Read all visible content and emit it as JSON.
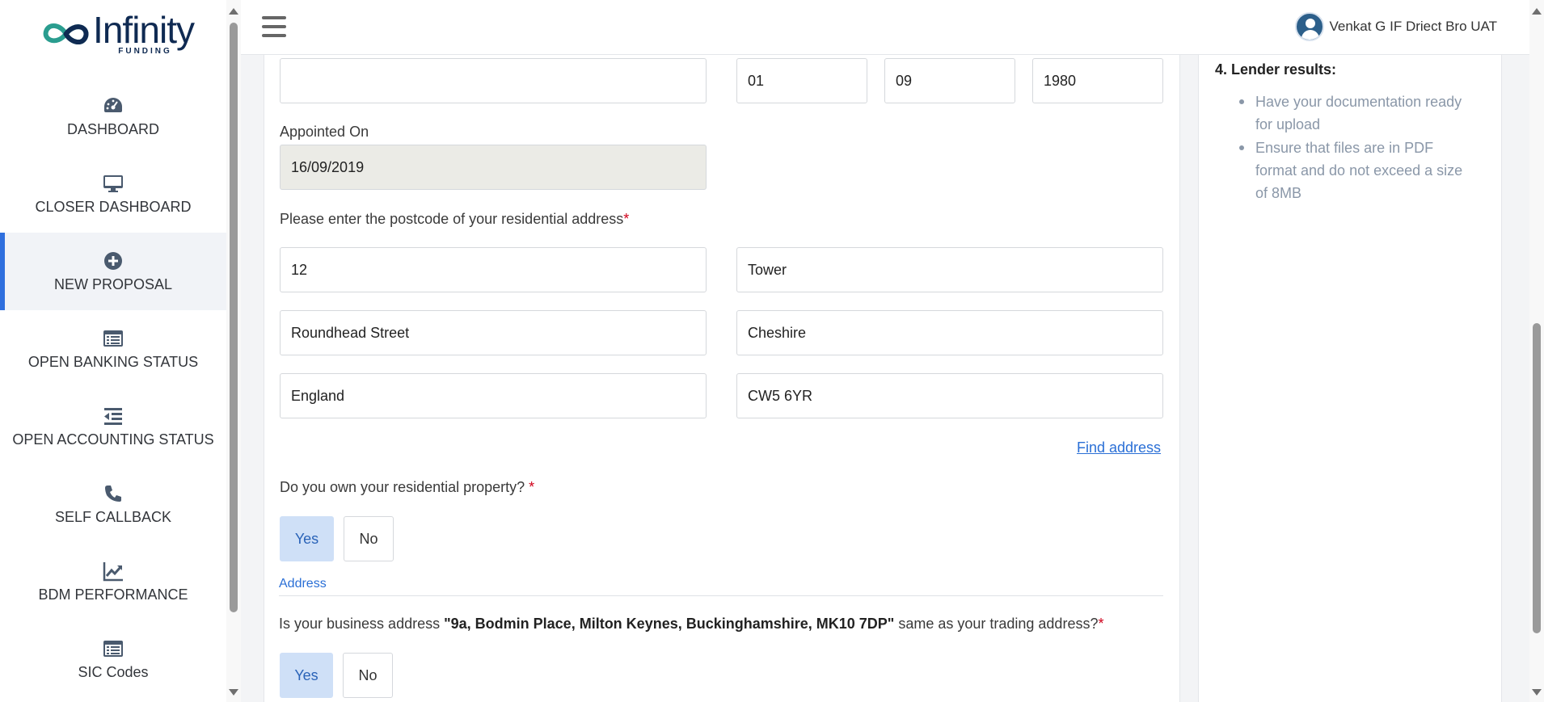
{
  "brand": {
    "name": "Infinity",
    "tagline": "FUNDING"
  },
  "sidebar": {
    "items": [
      {
        "label": "DASHBOARD",
        "icon": "dashboard-gauge-icon"
      },
      {
        "label": "CLOSER DASHBOARD",
        "icon": "monitor-icon"
      },
      {
        "label": "NEW PROPOSAL",
        "icon": "plus-circle-icon",
        "active": true
      },
      {
        "label": "OPEN BANKING STATUS",
        "icon": "list-card-icon"
      },
      {
        "label": "OPEN ACCOUNTING STATUS",
        "icon": "outdent-list-icon"
      },
      {
        "label": "SELF CALLBACK",
        "icon": "phone-icon"
      },
      {
        "label": "BDM PERFORMANCE",
        "icon": "trend-chart-icon"
      },
      {
        "label": "SIC Codes",
        "icon": "list-card-icon"
      }
    ]
  },
  "header": {
    "user_name": "Venkat G IF Driect Bro UAT"
  },
  "form": {
    "top_field_value": "",
    "dob": {
      "day": "01",
      "month": "09",
      "year": "1980"
    },
    "appointed_on": {
      "label": "Appointed On",
      "value": "16/09/2019"
    },
    "postcode_prompt": "Please enter the postcode of your residential address",
    "required_mark": "*",
    "address": {
      "line1": "12",
      "line2": "Tower",
      "street": "Roundhead Street",
      "county": "Cheshire",
      "country": "England",
      "postcode": "CW5 6YR"
    },
    "find_address": "Find address",
    "own_property": {
      "question": "Do you own your residential property?",
      "required_mark": " *",
      "yes": "Yes",
      "no": "No",
      "selected": "Yes"
    },
    "address_section_label": "Address",
    "business_address": {
      "prefix": "Is your business address ",
      "address": "\"9a, Bodmin Place, Milton Keynes, Buckinghamshire, MK10 7DP\"",
      "suffix": " same as your trading address?",
      "required_mark": "*",
      "yes": "Yes",
      "no": "No",
      "selected": "Yes"
    }
  },
  "right_panel": {
    "heading": "4. Lender results:",
    "bullets": [
      "Have your documentation ready for upload",
      "Ensure that files are in PDF format and do not exceed a size of 8MB"
    ]
  }
}
